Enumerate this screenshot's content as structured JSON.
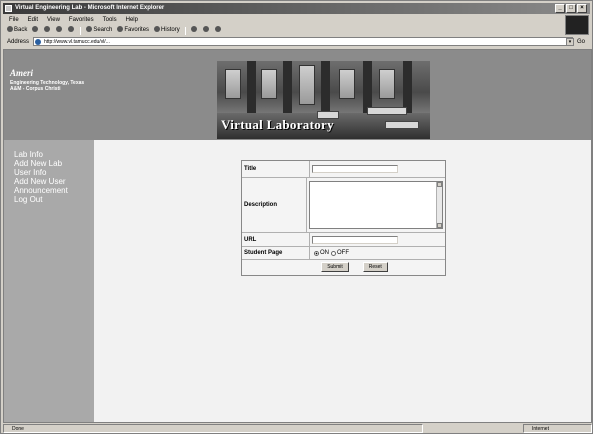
{
  "window": {
    "title": "Virtual Engineering Lab - Microsoft Internet Explorer"
  },
  "menu": [
    "File",
    "Edit",
    "View",
    "Favorites",
    "Tools",
    "Help"
  ],
  "toolbar": {
    "back": "Back",
    "search": "Search",
    "favorites": "Favorites",
    "history": "History"
  },
  "address": {
    "label": "Address",
    "url": "http://www.vl.tamucc.edu/vl/...",
    "go": "Go"
  },
  "header": {
    "org_logo": "Ameri",
    "org_text": "Engineering Technology, Texas A&M - Corpus Christi",
    "banner_title": "Virtual Laboratory"
  },
  "nav": [
    "Lab Info",
    "Add New Lab",
    "User Info",
    "Add New User",
    "Announcement",
    "Log Out"
  ],
  "form": {
    "title_label": "Title",
    "description_label": "Description",
    "url_label": "URL",
    "student_page_label": "Student Page",
    "radio_on": "ON",
    "radio_off": "OFF",
    "student_page_value": "ON",
    "submit": "Submit",
    "reset": "Reset"
  },
  "status": {
    "text": "Done",
    "zone": "Internet"
  }
}
